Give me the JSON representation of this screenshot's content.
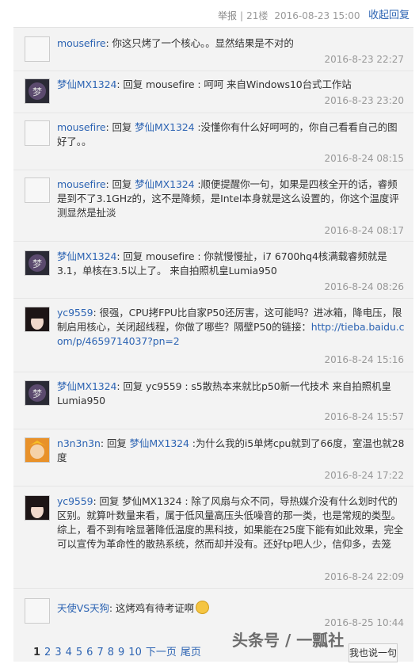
{
  "header": {
    "report": "举报",
    "floor": "21楼",
    "time": "2016-08-23 15:00",
    "reply_button": "收起回复"
  },
  "comments": [
    {
      "user": "mousefire",
      "text": ": 你这只烤了一个核心。。显然结果是不对的",
      "time": "2016-8-23 22:27",
      "avatar": "default"
    },
    {
      "user": "梦仙MX1324",
      "text": ": 回复 mousefire : 呵呵 来自Windows10台式工作站",
      "time": "2016-8-23 23:20",
      "avatar": "dark"
    },
    {
      "user": "mousefire",
      "reply_prefix": ": 回复 ",
      "reply_to": "梦仙MX1324",
      "text": " :没懂你有什么好呵呵的，你自己看看自己的图好了。。",
      "time": "2016-8-24 08:15",
      "avatar": "default"
    },
    {
      "user": "mousefire",
      "reply_prefix": ": 回复 ",
      "reply_to": "梦仙MX1324",
      "text": " :顺便提醒你一句，如果是四核全开的话，睿频是到不了3.1GHz的，这不是降频，是Intel本身就是这么设置的，你这个温度评测显然是扯淡",
      "time": "2016-8-24 08:17",
      "avatar": "default"
    },
    {
      "user": "梦仙MX1324",
      "text": ": 回复 mousefire : 你就慢慢扯，i7 6700hq4核满载睿频就是3.1，单核在3.5以上了。 来自拍照机皇Lumia950",
      "time": "2016-8-24 08:26",
      "avatar": "dark"
    },
    {
      "user": "yc9559",
      "text": ": 很强，CPU拷FPU比自家P50还厉害，这可能吗？进冰箱，降电压，限制启用核心，关闭超线程，你做了哪些？隔壁P50的链接：",
      "link": "http://tieba.baidu.com/p/4659714037?pn=2",
      "time": "2016-8-24 15:16",
      "avatar": "girl"
    },
    {
      "user": "梦仙MX1324",
      "text": ": 回复 yc9559 : s5散热本来就比p50新一代技术 来自拍照机皇Lumia950",
      "time": "2016-8-24 15:57",
      "avatar": "dark"
    },
    {
      "user": "n3n3n3n",
      "reply_prefix": ": 回复 ",
      "reply_to": "梦仙MX1324",
      "text": " :为什么我的i5单烤cpu就到了66度，室温也就28度",
      "time": "2016-8-24 17:22",
      "avatar": "orange"
    },
    {
      "user": "yc9559",
      "text": ": 回复 梦仙MX1324 : 除了风扇与众不同，导热媒介没有什么划时代的区别。就算叶数量来看，属于低风量高压头低噪音的那一类，也是常规的类型。综上，看不到有啥显著降低温度的黑科技，如果能在25度下能有如此效果，完全可以宣传为革命性的散热系统，然而却并没有。还好tp吧人少，信仰多，去笼",
      "time": "2016-8-24 22:09",
      "avatar": "girl"
    },
    {
      "user": "天使VS天狗",
      "text": ": 这烤鸡有待考证啊",
      "time": "2016-8-25 10:44",
      "avatar": "default",
      "emoji": "smile-emoji"
    }
  ],
  "pager": {
    "current": "1",
    "pages": [
      "2",
      "3",
      "4",
      "5",
      "6",
      "7",
      "8",
      "9",
      "10"
    ],
    "next": "下一页",
    "last": "尾页"
  },
  "watermark": "头条号 / 一瓢社",
  "reply_input_button": "我也说一句"
}
